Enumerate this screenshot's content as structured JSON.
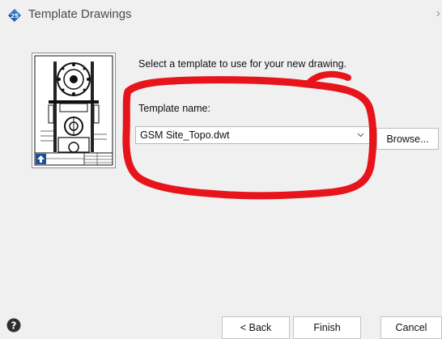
{
  "window": {
    "title": "Template Drawings",
    "title_icon": "autodesk-logo-icon",
    "next_chevron": "›"
  },
  "dialog": {
    "prompt": "Select a template to use for your new drawing.",
    "template_name_label": "Template name:",
    "template_value": "GSM Site_Topo.dwt",
    "browse_label": "Browse..."
  },
  "footer": {
    "help_icon": "question-circle-icon",
    "back_label": "< Back",
    "finish_label": "Finish",
    "cancel_label": "Cancel"
  },
  "colors": {
    "annotation": "#e8141c",
    "preview_blue": "#1b4f9c",
    "logo_blue": "#2e6fb5"
  }
}
